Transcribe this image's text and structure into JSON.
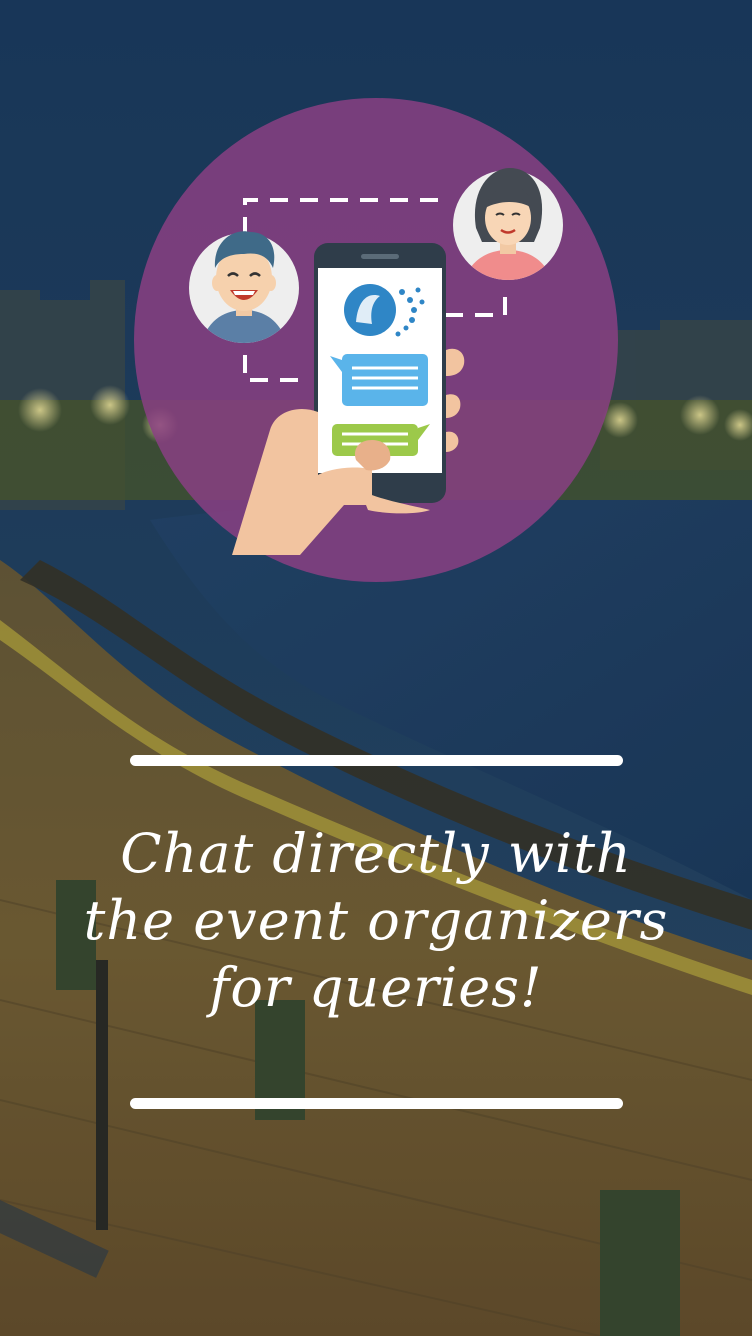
{
  "onboarding": {
    "caption_lines": [
      "Chat directly with",
      "the event organizers",
      "for queries!"
    ]
  },
  "icons": {
    "illustration": "chat-with-organizers-illustration",
    "background": "seafront-promenade-night-photo"
  },
  "colors": {
    "circle": "#8a3f82",
    "sky": "#1e3f63",
    "chat_bubble_blue": "#5ab4ea",
    "chat_bubble_green": "#9cc94a",
    "divider": "#ffffff"
  }
}
